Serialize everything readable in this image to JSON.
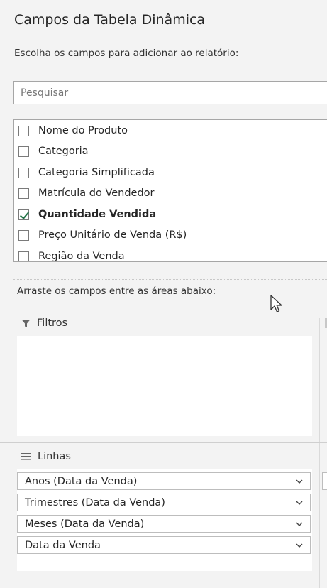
{
  "pane": {
    "title": "Campos da Tabela Dinâmica",
    "subtitle": "Escolha os campos para adicionar ao relatório:"
  },
  "search": {
    "placeholder": "Pesquisar",
    "value": ""
  },
  "fields": [
    {
      "label": "Nome do Produto",
      "checked": false
    },
    {
      "label": "Categoria",
      "checked": false
    },
    {
      "label": "Categoria Simplificada",
      "checked": false
    },
    {
      "label": "Matrícula do Vendedor",
      "checked": false
    },
    {
      "label": "Quantidade Vendida",
      "checked": true
    },
    {
      "label": "Preço Unitário de Venda (R$)",
      "checked": false
    },
    {
      "label": "Região da Venda",
      "checked": false
    }
  ],
  "areas": {
    "hint": "Arraste os campos entre as áreas abaixo:",
    "filters": {
      "label": "Filtros",
      "icon": "filter-icon"
    },
    "rows": {
      "label": "Linhas",
      "icon": "rows-icon",
      "items": [
        "Anos (Data da Venda)",
        "Trimestres (Data da Venda)",
        "Meses (Data da Venda)",
        "Data da Venda"
      ]
    }
  },
  "colors": {
    "check_accent": "#217346",
    "pane_background": "#f3f3f3"
  }
}
